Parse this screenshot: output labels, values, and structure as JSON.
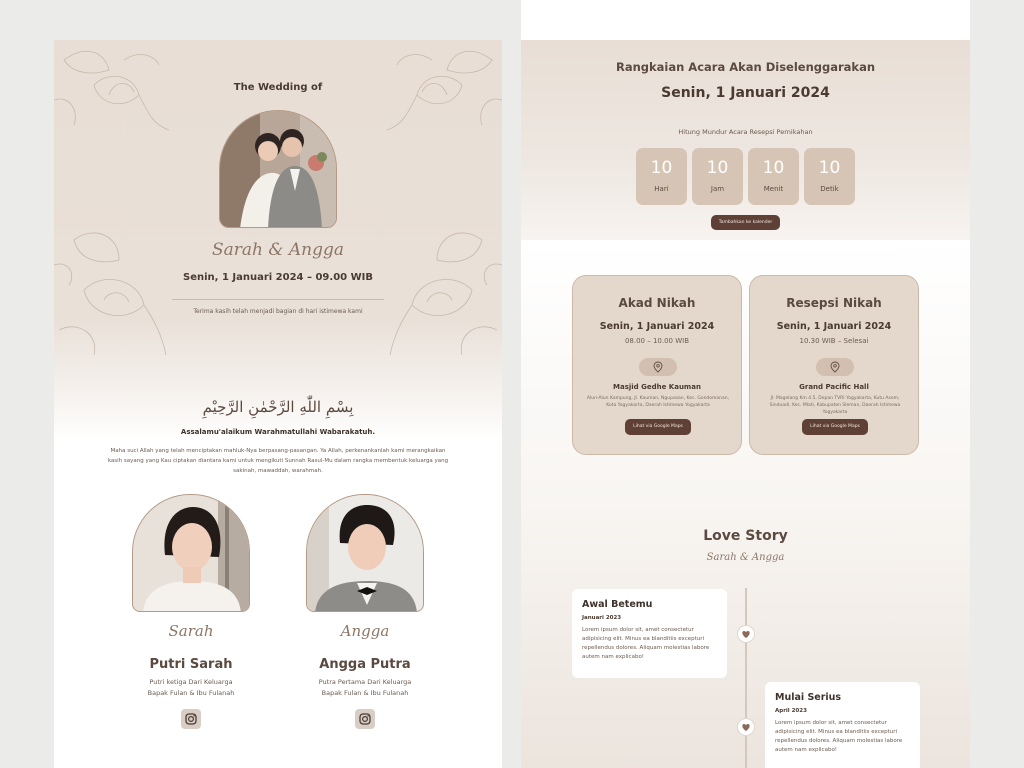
{
  "left": {
    "hero_title": "The Wedding of",
    "couple_script": "Sarah & Angga",
    "wedding_datetime": "Senin, 1 Januari 2024 – 09.00 WIB",
    "thanks": "Terima kasih telah menjadi bagian di hari istimewa kami",
    "bismillah": "بِسْمِ اللّٰهِ الرَّحْمٰنِ الرَّحِيْمِ",
    "salam": "Assalamu'alaikum Warahmatullahi Wabarakatuh.",
    "verse": "Maha suci Allah yang telah menciptakan mahluk-Nya berpasang-pasangan. Ya Allah, perkenankanlah kami merangkaikan kasih sayang yang Kau ciptakan diantara kami untuk mengikuti Sunnah Rasul-Mu dalam rangka membentuk keluarga yang sakinah, mawaddah, warahmah.",
    "bride": {
      "script": "Sarah",
      "full_name": "Putri Sarah",
      "line1": "Putri ketiga Dari Keluarga",
      "line2": "Bapak Fulan & Ibu Fulanah",
      "icon": "instagram-icon"
    },
    "groom": {
      "script": "Angga",
      "full_name": "Angga Putra",
      "line1": "Putra Pertama Dari Keluarga",
      "line2": "Bapak Fulan & Ibu Fulanah",
      "icon": "instagram-icon"
    }
  },
  "right": {
    "title": "Rangkaian Acara Akan Diselenggarakan",
    "date": "Senin, 1 Januari 2024",
    "countdown_label": "Hitung Mundur Acara Resepsi Pernikahan",
    "countdown": [
      {
        "value": "10",
        "label": "Hari"
      },
      {
        "value": "10",
        "label": "Jam"
      },
      {
        "value": "10",
        "label": "Menit"
      },
      {
        "value": "10",
        "label": "Detik"
      }
    ],
    "calendar_button": "Tambahkan ke kalender",
    "events": [
      {
        "title": "Akad Nikah",
        "date": "Senin, 1 Januari 2024",
        "time": "08.00 – 10.00 WIB",
        "venue": "Masjid Gedhe Kauman",
        "address": "Alun-Alun Kampung, Jl. Kauman, Ngupasan, Kec. Gondomanan, Kota Yogyakarta, Daerah Istimewa Yogyakarta",
        "button": "Lihat via Google Maps"
      },
      {
        "title": "Resepsi Nikah",
        "date": "Senin, 1 Januari 2024",
        "time": "10.30 WIB – Selesai",
        "venue": "Grand Pacific Hall",
        "address": "Jl. Magelang Km 4.5, Depan TVRI Yogyakarta, Kutu Asem, Sinduadi, Kec. Mlati, Kabupaten Sleman, Daerah Istimewa Yogyakarta",
        "button": "Lihat via Google Maps"
      }
    ],
    "love_story": {
      "title": "Love Story",
      "subtitle": "Sarah & Angga",
      "items": [
        {
          "title": "Awal Betemu",
          "date": "Januari 2023",
          "text": "Lorem ipsum dolor sit, amet consectetur adipisicing elit. Minus ea blanditiis excepturi repellendus dolores. Aliquam molestias labore autem nam explicabo!"
        },
        {
          "title": "Mulai Serius",
          "date": "April 2023",
          "text": "Lorem ipsum dolor sit, amet consectetur adipisicing elit. Minus ea blanditiis excepturi repellendus dolores. Aliquam molestias labore autem nam explicabo!"
        }
      ]
    }
  },
  "colors": {
    "accent": "#5e4036",
    "beige": "#e8ded5",
    "card": "#e4d8cd",
    "countdown_box": "#d6c5b5"
  }
}
